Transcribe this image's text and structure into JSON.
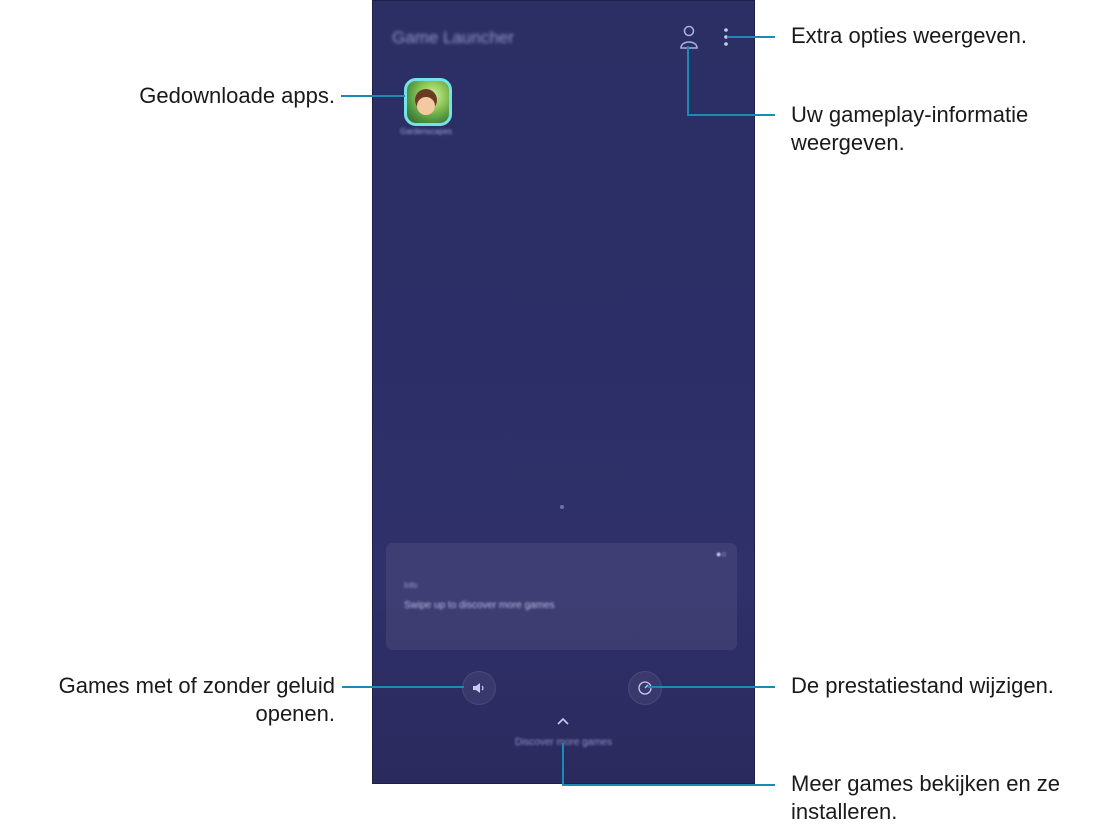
{
  "app": {
    "title": "Game Launcher",
    "installed_apps": [
      {
        "name": "Gardenscapes"
      }
    ],
    "card": {
      "indicator": "●○",
      "label": "Info",
      "text": "Swipe up to discover more games"
    },
    "discover_link": "Discover more games"
  },
  "callouts": {
    "gedownloade_apps": "Gedownloade apps.",
    "extra_opties": "Extra opties weergeven.",
    "gameplay_line1": "Uw gameplay-informatie",
    "gameplay_line2": "weergeven.",
    "geluid_line1": "Games met of zonder geluid",
    "geluid_line2": "openen.",
    "prestatiestand": "De prestatiestand wijzigen.",
    "meer_games_line1": "Meer games bekijken en ze",
    "meer_games_line2": "installeren."
  },
  "colors": {
    "callout_line": "#1b8ab5",
    "screen_bg": "#2c2f67",
    "app_tile_border": "#74e3e6"
  },
  "icons": {
    "profile": "person-icon",
    "more": "more-options-icon",
    "sound": "speaker-icon",
    "performance": "performance-mode-icon",
    "discover": "chevron-up-icon"
  }
}
